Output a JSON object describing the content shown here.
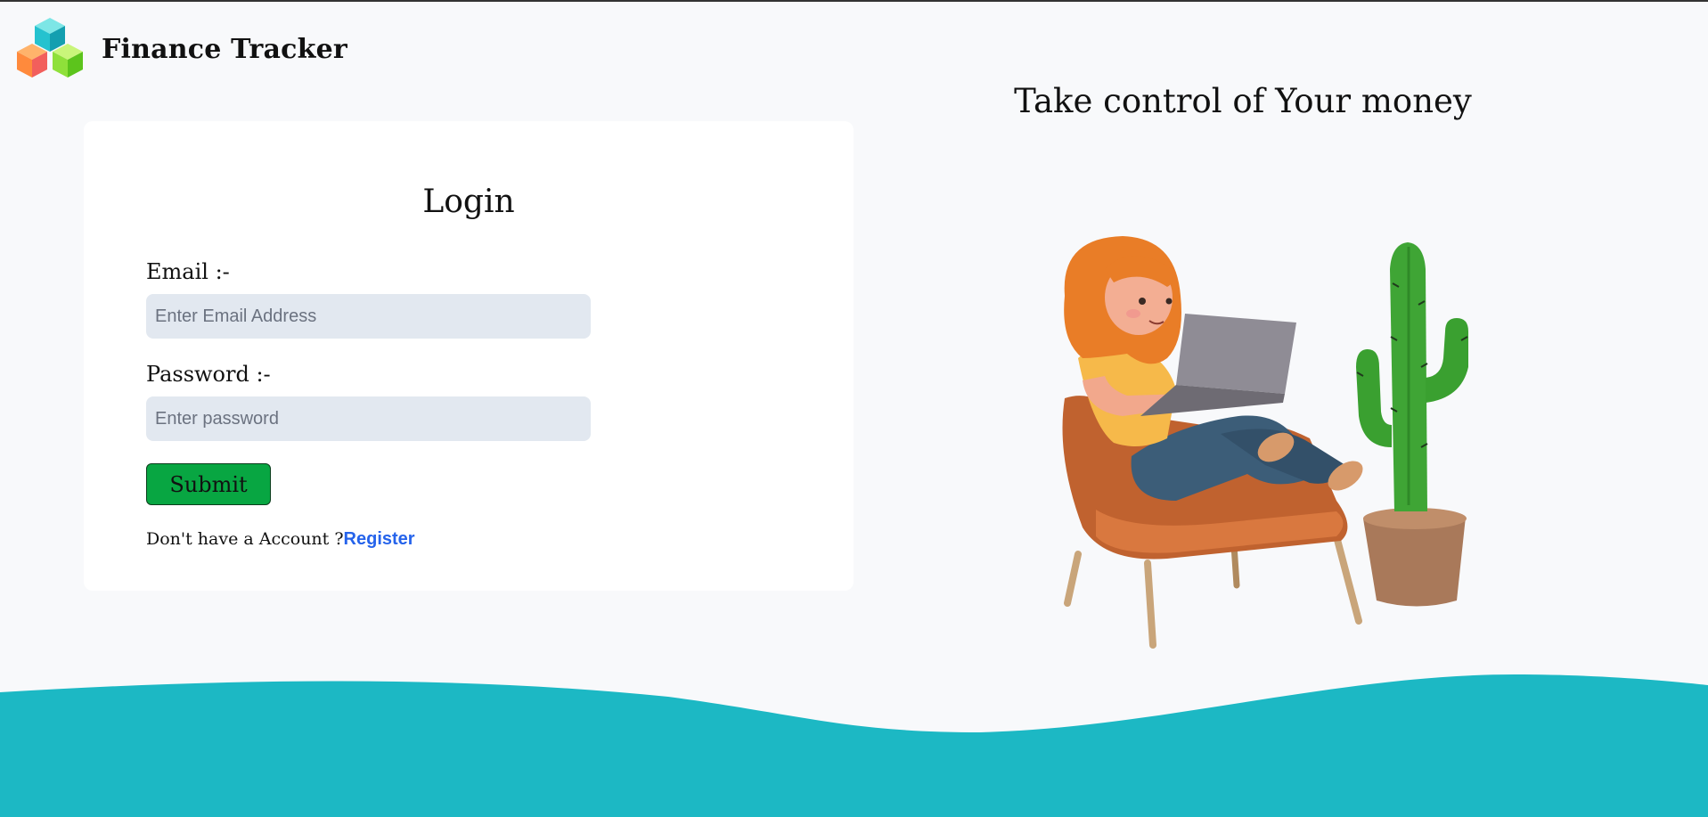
{
  "header": {
    "app_title": "Finance Tracker",
    "logo_icon": "cubes-logo-icon"
  },
  "login_form": {
    "heading": "Login",
    "email_label": "Email :-",
    "email_placeholder": "Enter Email Address",
    "email_value": "",
    "password_label": "Password :-",
    "password_placeholder": "Enter password",
    "password_value": "",
    "submit_label": "Submit",
    "register_prompt": "Don't have a Account ?",
    "register_link": "Register"
  },
  "hero": {
    "tagline": "Take control of Your money",
    "illustration": "woman-with-laptop-illustration"
  },
  "colors": {
    "accent_wave": "#1cb8c4",
    "submit_button": "#08a642",
    "link": "#2563eb",
    "input_bg": "#e2e8f0"
  }
}
